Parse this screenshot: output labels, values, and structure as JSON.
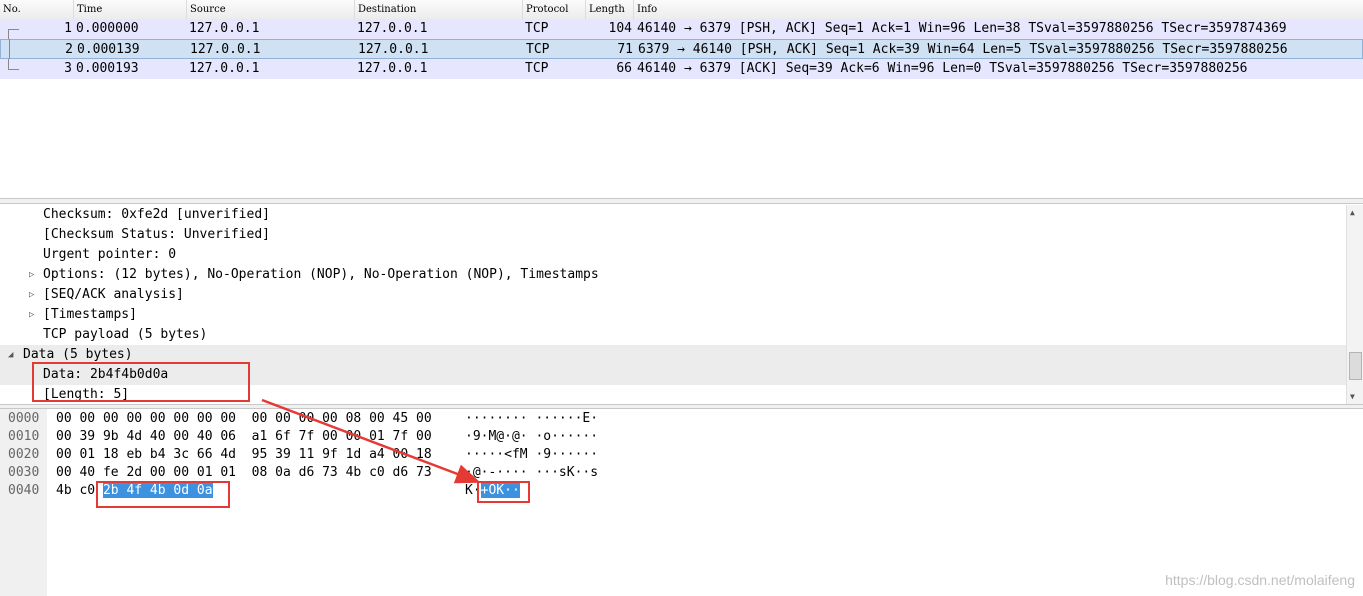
{
  "packet_list": {
    "columns": [
      "No.",
      "Time",
      "Source",
      "Destination",
      "Protocol",
      "Length",
      "Info"
    ],
    "rows": [
      {
        "no": "1",
        "time": "0.000000",
        "source": "127.0.0.1",
        "destination": "127.0.0.1",
        "protocol": "TCP",
        "length": "104",
        "info": "46140 → 6379 [PSH, ACK] Seq=1 Ack=1 Win=96 Len=38 TSval=3597880256 TSecr=3597874369"
      },
      {
        "no": "2",
        "time": "0.000139",
        "source": "127.0.0.1",
        "destination": "127.0.0.1",
        "protocol": "TCP",
        "length": "71",
        "info": "6379 → 46140 [PSH, ACK] Seq=1 Ack=39 Win=64 Len=5 TSval=3597880256 TSecr=3597880256"
      },
      {
        "no": "3",
        "time": "0.000193",
        "source": "127.0.0.1",
        "destination": "127.0.0.1",
        "protocol": "TCP",
        "length": "66",
        "info": "46140 → 6379 [ACK] Seq=39 Ack=6 Win=96 Len=0 TSval=3597880256 TSecr=3597880256"
      }
    ]
  },
  "details": {
    "lines": [
      {
        "text": "Checksum: 0xfe2d [unverified]",
        "expander": ""
      },
      {
        "text": "[Checksum Status: Unverified]",
        "expander": ""
      },
      {
        "text": "Urgent pointer: 0",
        "expander": ""
      },
      {
        "text": "Options: (12 bytes), No-Operation (NOP), No-Operation (NOP), Timestamps",
        "expander": "▷"
      },
      {
        "text": "[SEQ/ACK analysis]",
        "expander": "▷"
      },
      {
        "text": "[Timestamps]",
        "expander": "▷"
      },
      {
        "text": "TCP payload (5 bytes)",
        "expander": ""
      },
      {
        "text": "Data (5 bytes)",
        "expander": "◢"
      },
      {
        "text": "Data: 2b4f4b0d0a",
        "expander": ""
      },
      {
        "text": "[Length: 5]",
        "expander": ""
      }
    ]
  },
  "bytes": {
    "lines": [
      {
        "offset": "0000",
        "hex": "00 00 00 00 00 00 00 00  00 00 00 00 08 00 45 00",
        "ascii": "········ ······E·"
      },
      {
        "offset": "0010",
        "hex": "00 39 9b 4d 40 00 40 06  a1 6f 7f 00 00 01 7f 00",
        "ascii": "·9·M@·@· ·o······"
      },
      {
        "offset": "0020",
        "hex": "00 01 18 eb b4 3c 66 4d  95 39 11 9f 1d a4 00 18",
        "ascii": "·····<fM ·9······"
      },
      {
        "offset": "0030",
        "hex": "00 40 fe 2d 00 00 01 01  08 0a d6 73 4b c0 d6 73",
        "ascii": "·@·-···· ···sK··s"
      },
      {
        "offset": "0040",
        "hex_plain": "4b c0 ",
        "hex_sel": "2b 4f 4b 0d 0a",
        "ascii_plain": "K·",
        "ascii_sel": "+OK··"
      }
    ]
  },
  "watermark": "https://blog.csdn.net/molaifeng",
  "colors": {
    "row_bg": "#e7e6ff",
    "selected_row": "#cfe1f3",
    "highlight": "#3d92e0",
    "annotation": "#e53935"
  }
}
